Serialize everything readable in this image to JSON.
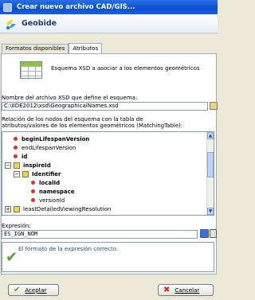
{
  "window": {
    "title": "Crear nuevo archivo CAD/GIS..."
  },
  "banner": {
    "brand": "Geobide"
  },
  "tabs": [
    {
      "label": "Formatos disponibles",
      "active": false
    },
    {
      "label": "Atributos",
      "active": true
    }
  ],
  "schema": {
    "description": "Esquema XSD a asociar a los elementos geométricos",
    "file_label": "Nombre del archivo XSD que define el esquema:",
    "file_value": "C:\\IIDE2012\\xsd\\GeographicalNames.xsd"
  },
  "relation": {
    "label_line1": "Relación de los nodos del esquema con la tabla de",
    "label_line2": "atributos/valores de los elementos geométricos (MatchingTable):"
  },
  "tree": {
    "rows": [
      {
        "label": "beginLifespanVersion",
        "bold": true
      },
      {
        "label": "endLifespanVersion",
        "bold": false
      },
      {
        "label": "id",
        "bold": true
      },
      {
        "label": "inspireId",
        "bold": true,
        "expand": "−"
      },
      {
        "label": "Identifier",
        "bold": true,
        "expand": "−"
      },
      {
        "label": "localId",
        "bold": true
      },
      {
        "label": "namespace",
        "bold": true
      },
      {
        "label": "versionId",
        "bold": false
      },
      {
        "label": "leastDetailedViewingResolution",
        "bold": false,
        "expand": "+"
      }
    ]
  },
  "expression": {
    "label": "Expresión:",
    "value": "ES_IGN_NOM",
    "status": "El formato de la expresión correcto."
  },
  "buttons": {
    "accept": "Aceptar",
    "cancel": "Cancelar"
  },
  "colors": {
    "titlebar": "#0b4fd0",
    "ok": "#58a42b",
    "leaf": "#d9322f"
  }
}
